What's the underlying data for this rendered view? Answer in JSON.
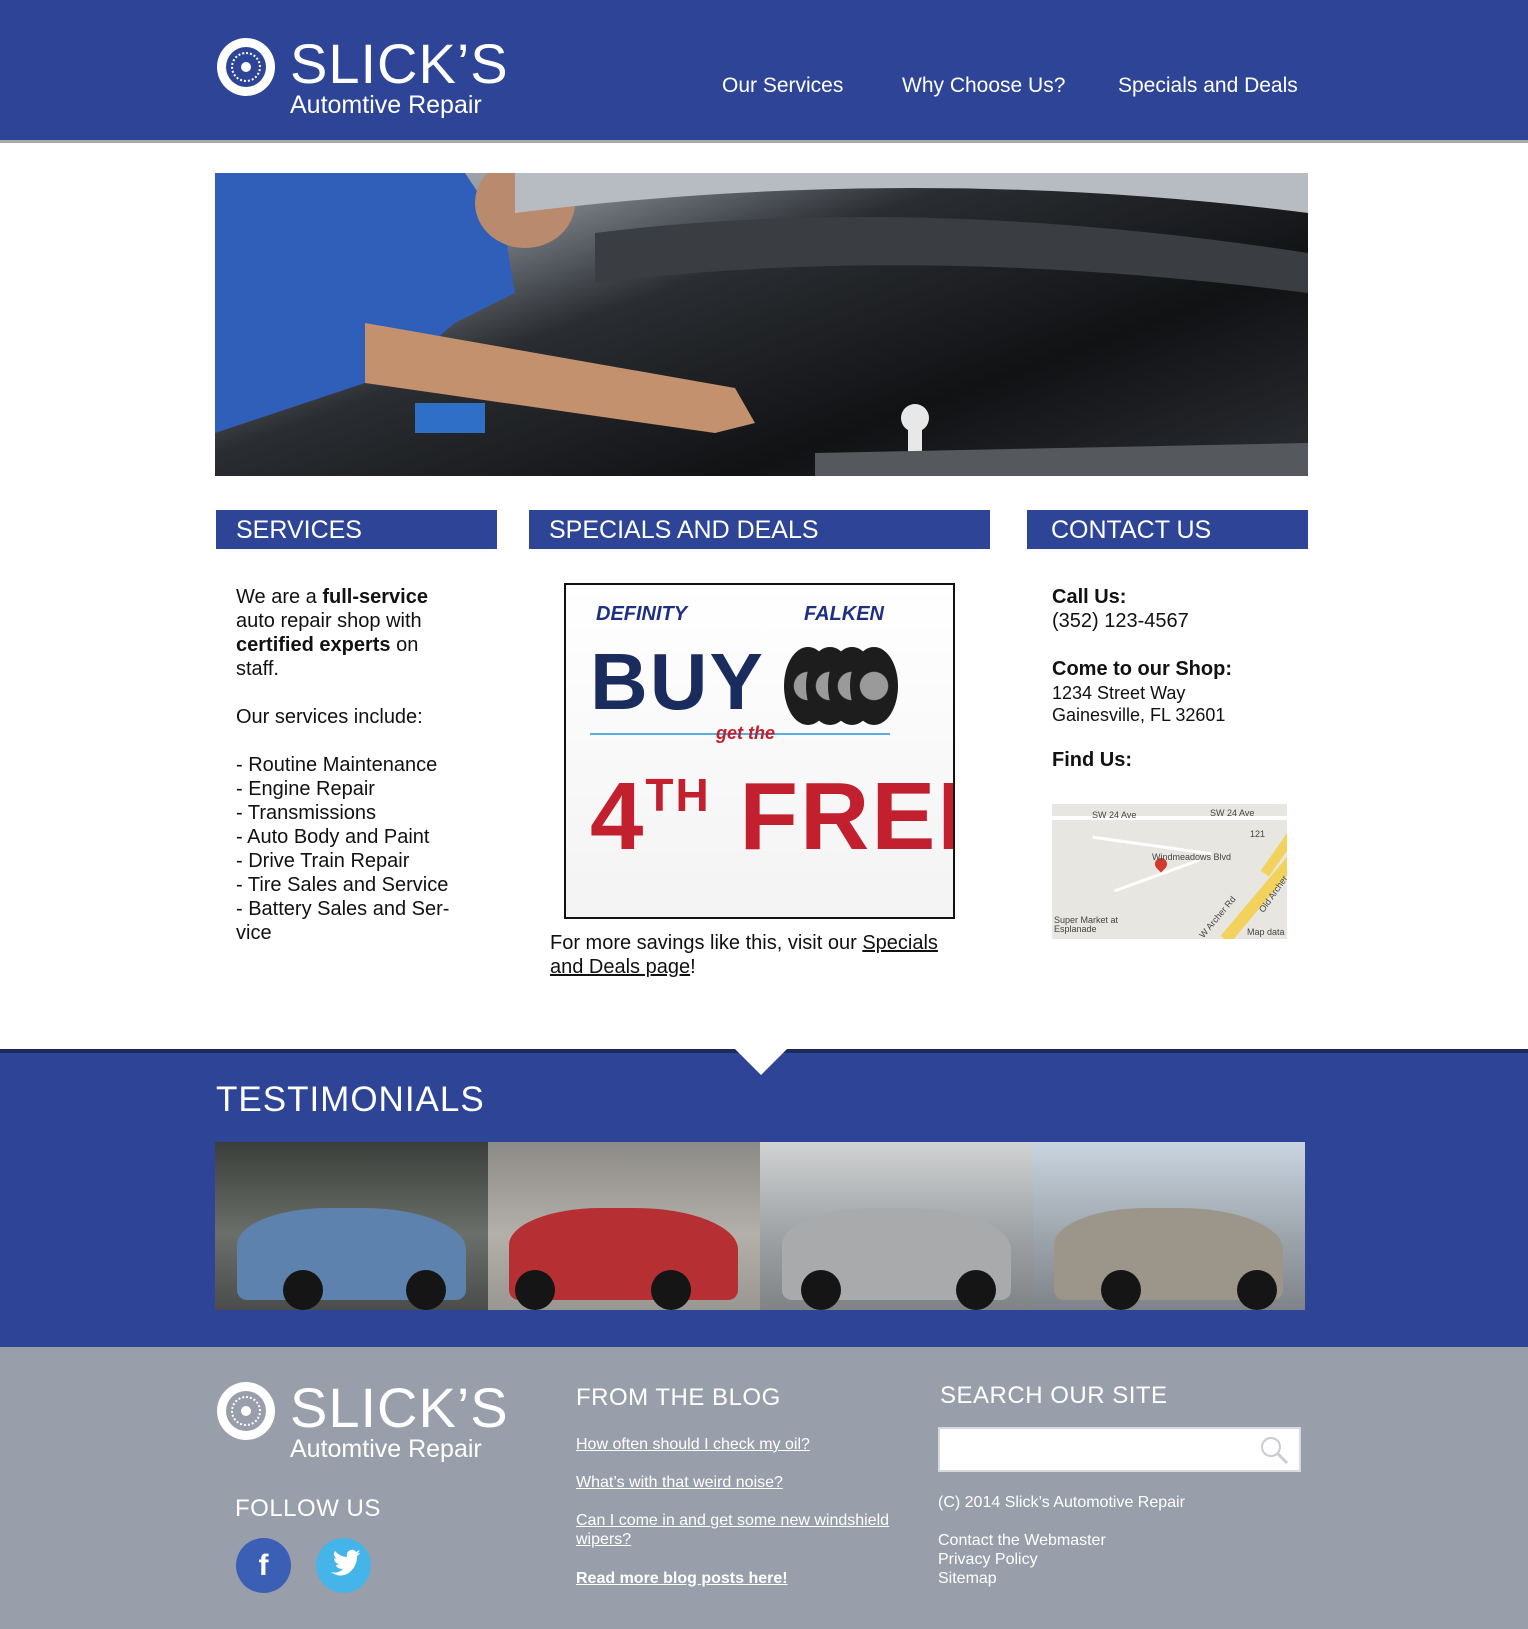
{
  "header": {
    "logo_name": "SLICK’S",
    "logo_sub": "Automtive Repair",
    "nav": [
      "Our Services",
      "Why Choose Us?",
      "Specials and Deals"
    ]
  },
  "sections": {
    "services_title": "SERVICES",
    "specials_title": "SPECIALS AND DEALS",
    "contact_title": "CONTACT US"
  },
  "services": {
    "intro_1": "We are a ",
    "intro_bold_1": "full-service",
    "intro_2": " auto repair shop with ",
    "intro_bold_2": "certified experts",
    "intro_3": " on staff.",
    "include_label": "Our services include:",
    "items": [
      "- Routine Maintenance",
      "- Engine Repair",
      "- Transmissions",
      "- Auto Body and Paint",
      "- Drive Train Repair",
      "- Tire Sales and Service",
      "- Battery Sales and Ser-vice"
    ]
  },
  "specials": {
    "ad_brand_1": "DEFINITY",
    "ad_brand_2": "FALKEN",
    "ad_buy": "BUY 3",
    "ad_get_the": "get the",
    "ad_num": "4",
    "ad_th": "TH",
    "ad_free": "FREE",
    "note_prefix": "For more savings like this, visit our ",
    "note_link": "Specials and Deals page",
    "note_suffix": "!"
  },
  "contact": {
    "call_label": "Call Us:",
    "phone": "(352) 123-4567",
    "shop_label": "Come to our Shop:",
    "address_1": "1234 Street Way",
    "address_2": "Gainesville, FL 32601",
    "find_label": "Find Us:",
    "map_labels": [
      "SW 24 Ave",
      "SW 24 Ave",
      "121",
      "Windmeadows Blvd",
      "Super Market at Esplanade",
      "W Archer Rd",
      "Old Archer",
      "Map data"
    ]
  },
  "testimonials": {
    "title": "TESTIMONIALS",
    "photos": [
      "damaged-blue-sedan",
      "damaged-red-coupe",
      "silver-pt-cruiser-open-hood",
      "damaged-gold-sedan"
    ]
  },
  "footer": {
    "logo_name": "SLICK’S",
    "logo_sub": "Automtive Repair",
    "follow_title": "FOLLOW US",
    "social": [
      "f",
      "twitter"
    ],
    "blog_title": "FROM THE BLOG",
    "blog_links": [
      "How often should I check my oil?",
      "What’s with that weird noise?",
      "Can I come in and get some new windshield wipers?"
    ],
    "blog_more": "Read more blog posts here!",
    "search_title": "SEARCH OUR SITE",
    "search_placeholder": "",
    "copyright": "(C) 2014 Slick’s Automotive Repair",
    "links": [
      "Contact the Webmaster",
      "Privacy Policy",
      "Sitemap"
    ]
  },
  "colors": {
    "brand_blue": "#2e4597",
    "footer_gray": "#999eab",
    "ad_red": "#c3202f",
    "ad_navy": "#1a2b5e",
    "facebook": "#3b5fb5",
    "twitter": "#45b4e8"
  }
}
